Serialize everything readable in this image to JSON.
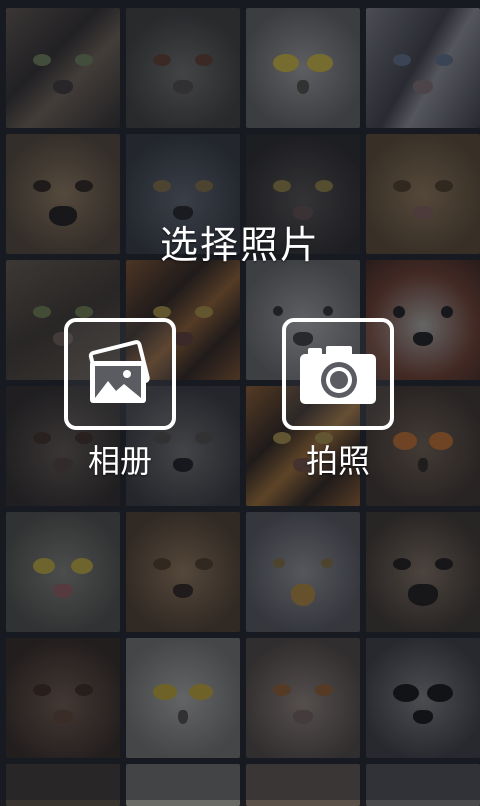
{
  "screen": {
    "title": "选择照片"
  },
  "actions": {
    "album_label": "相册",
    "camera_label": "拍照"
  },
  "icons": {
    "album": "photo-album-icon",
    "camera": "camera-icon"
  },
  "colors": {
    "overlay_text": "#ffffff",
    "button_border": "#ffffff"
  }
}
